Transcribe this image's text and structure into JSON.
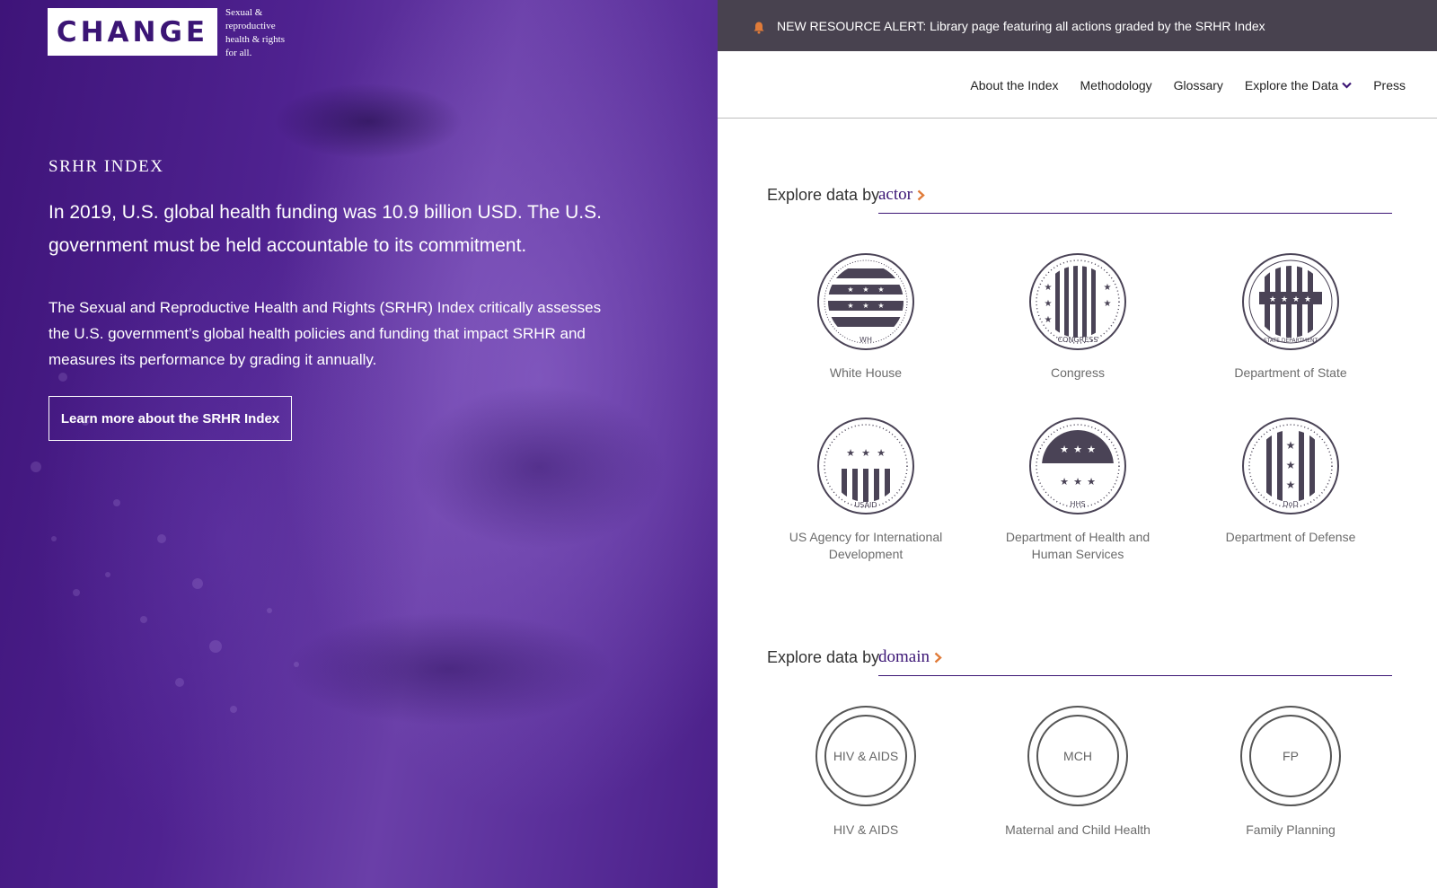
{
  "brand": {
    "logo_text": "CHANGE",
    "tagline_lines": [
      "Sexual &",
      "reproductive",
      "health & rights",
      "for all."
    ]
  },
  "hero": {
    "eyebrow": "SRHR INDEX",
    "headline": "In 2019, U.S. global health funding was 10.9 billion USD. The U.S. government must be held accountable to its commitment.",
    "body": "The Sexual and Reproductive Health and Rights (SRHR) Index critically assesses the U.S. government’s global health policies and funding that impact SRHR and measures its performance by grading it annually.",
    "cta_label": "Learn more about the SRHR Index"
  },
  "alert": {
    "icon": "bell-icon",
    "text": "NEW RESOURCE ALERT: Library page featuring all actions graded by the SRHR Index"
  },
  "nav": {
    "items": [
      {
        "label": "About the Index"
      },
      {
        "label": "Methodology"
      },
      {
        "label": "Glossary"
      },
      {
        "label": "Explore the Data"
      },
      {
        "label": "Press"
      }
    ]
  },
  "actor_section": {
    "prefix": "Explore data by",
    "key": "actor",
    "tiles": [
      {
        "label": "White House",
        "seal_text": "WH"
      },
      {
        "label": "Congress",
        "seal_text": "CONGRESS"
      },
      {
        "label": "Department of State",
        "seal_text": "STATE DEPARTMENT"
      },
      {
        "label": "US Agency for International Development",
        "seal_text": "USAID"
      },
      {
        "label": "Department of Health and Human Services",
        "seal_text": "HHS"
      },
      {
        "label": "Department of Defense",
        "seal_text": "DoD"
      }
    ]
  },
  "domain_section": {
    "prefix": "Explore data by",
    "key": "domain",
    "tiles": [
      {
        "abbr": "HIV & AIDS",
        "label": "HIV & AIDS"
      },
      {
        "abbr": "MCH",
        "label": "Maternal and Child Health"
      },
      {
        "abbr": "FP",
        "label": "Family Planning"
      }
    ]
  },
  "colors": {
    "brand_purple": "#3b1575",
    "accent_orange": "#e07b39",
    "alert_bg": "#48424f",
    "seal_gray": "#4a4356"
  }
}
